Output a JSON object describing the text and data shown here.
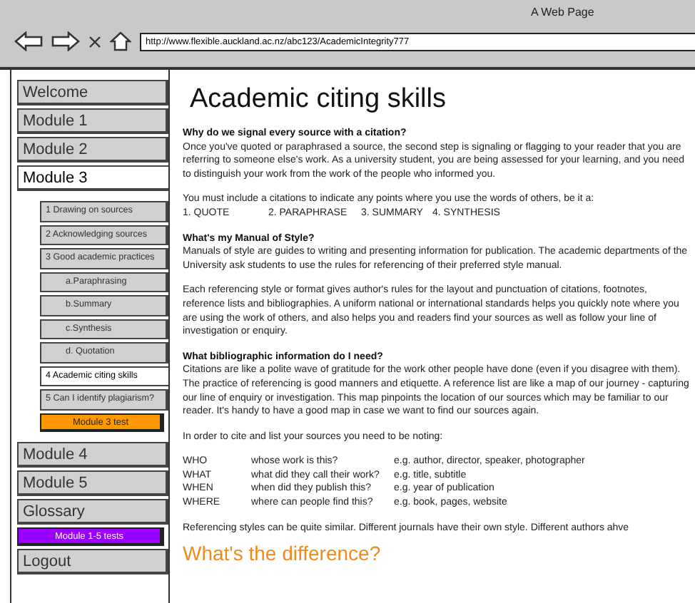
{
  "browser": {
    "title": "A Web Page",
    "url": "http://www.flexible.auckland.ac.nz/abc123/AcademicIntegrity777"
  },
  "nav": [
    {
      "label": "Welcome",
      "kind": "module",
      "selected": false
    },
    {
      "label": "Module 1",
      "kind": "module",
      "selected": false
    },
    {
      "label": "Module 2",
      "kind": "module",
      "selected": false
    },
    {
      "label": "Module 3",
      "kind": "module",
      "selected": true,
      "children": [
        {
          "label": "1 Drawing on sources",
          "kind": "sub",
          "selected": false
        },
        {
          "label": "2 Acknowledging sources",
          "kind": "sub",
          "selected": false
        },
        {
          "label": "3 Good academic practices",
          "kind": "sub",
          "selected": false,
          "children": [
            {
              "label": "a.Paraphrasing",
              "kind": "sub",
              "selected": false
            },
            {
              "label": "b.Summary",
              "kind": "sub",
              "selected": false
            },
            {
              "label": "c.Synthesis",
              "kind": "sub",
              "selected": false
            },
            {
              "label": "d. Quotation",
              "kind": "sub",
              "selected": false
            }
          ]
        },
        {
          "label": "4 Academic citing skills",
          "kind": "sub",
          "selected": true
        },
        {
          "label": "5 Can I identify plagiarism?",
          "kind": "sub",
          "selected": false
        },
        {
          "label": "Module 3 test",
          "kind": "test",
          "selected": false,
          "color": "#ff9900"
        }
      ]
    },
    {
      "label": "Module 4",
      "kind": "module",
      "selected": false
    },
    {
      "label": "Module 5",
      "kind": "module",
      "selected": false
    },
    {
      "label": "Glossary",
      "kind": "module",
      "selected": false
    },
    {
      "label": "Module 1-5 tests",
      "kind": "test",
      "selected": false,
      "color": "#9900ff"
    },
    {
      "label": "Logout",
      "kind": "module",
      "selected": false
    }
  ],
  "content": {
    "title": "Academic citing skills",
    "blocks": [
      {
        "kind": "heading",
        "text": "Why do we signal every source with a citation?"
      },
      {
        "kind": "paragraph",
        "text": "Once you've quoted or paraphrased a source, the second step is signaling or flagging to your reader that you are referring to someone else's work. As a university student, you are being assessed for your learning, and you need to distinguish your work from the work of the people who informed you."
      },
      {
        "kind": "gap"
      },
      {
        "kind": "paragraph",
        "text": "You must include a citations to indicate any points where you use the words of others, be it a:"
      },
      {
        "kind": "types",
        "items": [
          "1. QUOTE",
          "2. PARAPHRASE",
          "3. SUMMARY",
          "4. SYNTHESIS"
        ]
      },
      {
        "kind": "gap"
      },
      {
        "kind": "heading",
        "text": "What's my Manual of Style?"
      },
      {
        "kind": "paragraph",
        "text": "Manuals of style are guides to writing and presenting information for publication. The academic departments of the University ask students to use the rules for referencing of their preferred style manual."
      },
      {
        "kind": "gap"
      },
      {
        "kind": "paragraph",
        "text": "Each referencing style or format gives author's rules for the layout and punctuation of citations, footnotes, reference lists and bibliographies. A uniform national or international standards helps you quickly note where you are using the work of others, and also helps you and readers find your sources as well as follow your line of investigation or enquiry."
      },
      {
        "kind": "gap"
      },
      {
        "kind": "heading",
        "text": "What bibliographic information do I need?"
      },
      {
        "kind": "paragraph",
        "text": "Citations are like a polite wave of gratitude for the work other people have done (even if you disagree with them). The practice of referencing is good manners and etiquette. A reference list are like a map of our journey - capturing our line of enquiry or investigation. This map pinpoints the location of our sources which may be familiar to our reader. It's handy to have a good map in case we want to find our sources again."
      },
      {
        "kind": "gap"
      },
      {
        "kind": "paragraph",
        "text": "In order to cite and list your sources you need to be noting:"
      },
      {
        "kind": "gap"
      },
      {
        "kind": "table",
        "rows": [
          [
            "WHO",
            "whose work is this?",
            "e.g. author, director, speaker, photographer"
          ],
          [
            "WHAT",
            "what did they call their work?",
            "e.g. title, subtitle"
          ],
          [
            "WHEN",
            "when did they publish this?",
            "e.g. year of publication"
          ],
          [
            "WHERE",
            "where can people find this?",
            "e.g. book, pages, website"
          ]
        ]
      },
      {
        "kind": "gap"
      },
      {
        "kind": "paragraph",
        "text": "Referencing styles can be quite similar. Different journals have their own style. Different authors ahve"
      },
      {
        "kind": "subtitle",
        "text": "What's the difference?"
      }
    ]
  }
}
